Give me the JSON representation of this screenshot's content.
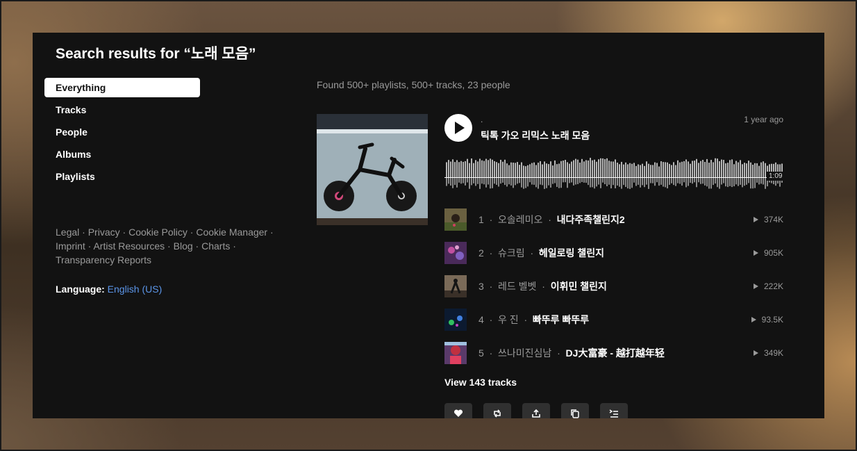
{
  "search": {
    "title_prefix": "Search results for ",
    "query_display": "“노래 모음”",
    "found_text": "Found 500+ playlists, 500+ tracks, 23 people"
  },
  "nav": {
    "everything": "Everything",
    "tracks": "Tracks",
    "people": "People",
    "albums": "Albums",
    "playlists": "Playlists"
  },
  "footer": {
    "legal": "Legal",
    "privacy": "Privacy",
    "cookie_policy": "Cookie Policy",
    "cookie_manager": "Cookie Manager",
    "imprint": "Imprint",
    "artist_resources": "Artist Resources",
    "blog": "Blog",
    "charts": "Charts",
    "transparency": "Transparency Reports",
    "separator": " · "
  },
  "language": {
    "label": "Language:",
    "value": "English (US)"
  },
  "result": {
    "uploader": ".",
    "title": "틱톡 가오 리믹스 노래 모음",
    "posted": "1 year ago",
    "duration": "1:09",
    "waveform_progress": 0,
    "tracks": [
      {
        "num": "1",
        "artist": "오솔레미오",
        "title": "내다주족챌린지2",
        "plays": "374K"
      },
      {
        "num": "2",
        "artist": "슈크림",
        "title": "헤일로링 챌린지",
        "plays": "905K"
      },
      {
        "num": "3",
        "artist": "레드 벨벳",
        "title": "이휘민 챌린지",
        "plays": "222K"
      },
      {
        "num": "4",
        "artist": "우 진",
        "title": "빠뚜루 빠뚜루",
        "plays": "93.5K"
      },
      {
        "num": "5",
        "artist": "쓰나미진심남",
        "title": "DJ大富豪 - 越打越年轻",
        "plays": "349K"
      }
    ],
    "view_all": "View 143 tracks",
    "separator": "·",
    "actions": [
      "heart-icon",
      "repost-icon",
      "share-icon",
      "copy-icon",
      "add-to-next-icon"
    ]
  },
  "colors": {
    "panel_bg": "#121212",
    "accent_link": "#5b95e8",
    "muted_text": "#9a9a9a"
  }
}
